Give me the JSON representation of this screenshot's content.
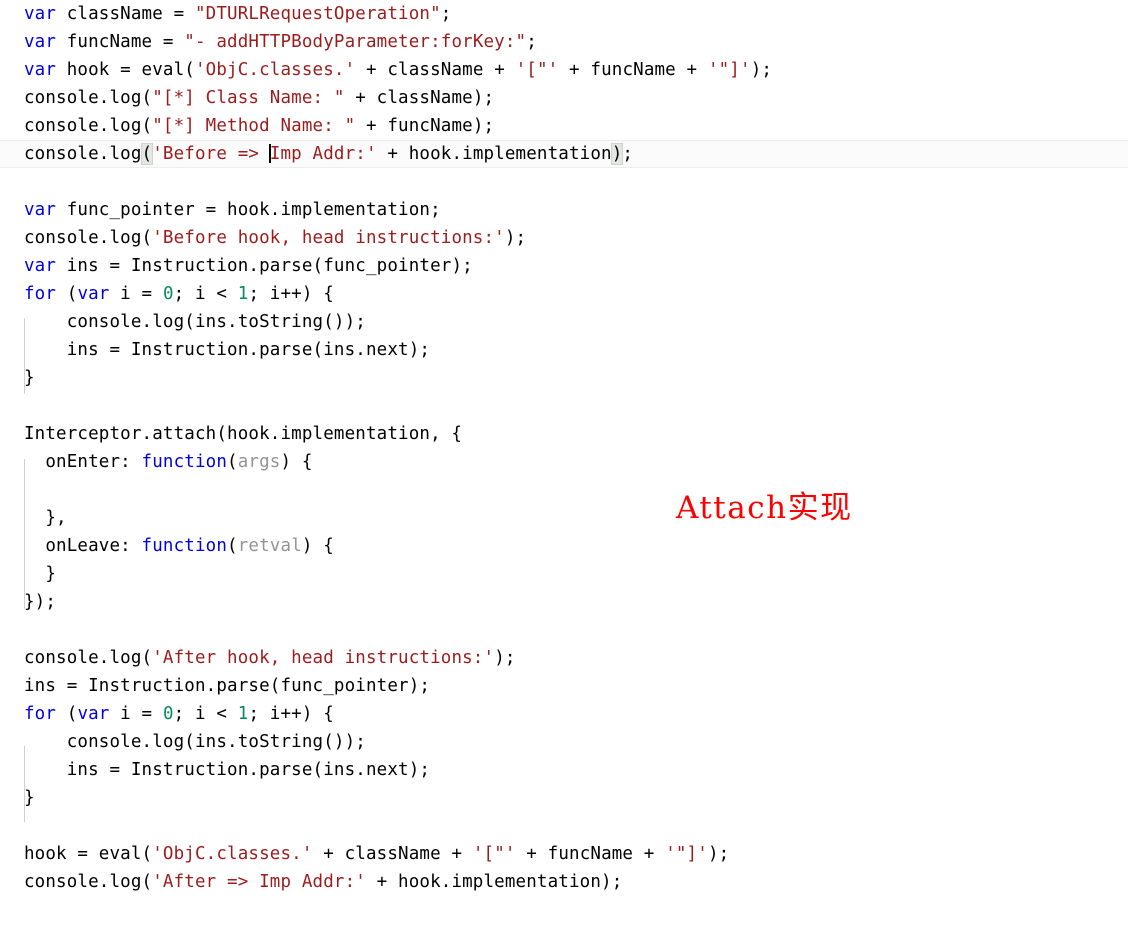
{
  "editor": {
    "language": "javascript",
    "background": "#ffffff",
    "colors": {
      "keyword": "#0000e0",
      "string": "#9c1c1c",
      "number": "#0a8a5c",
      "parameter": "#949494",
      "plain": "#000000",
      "current_line": "#fbfbfb",
      "bracket_match": "#e3e6e3",
      "indent_guide": "#cfcfcf",
      "annotation": "#fd0000"
    }
  },
  "annotation": {
    "text": "Attach实现"
  },
  "code": {
    "line1": {
      "kw": "var",
      "mid": " className = ",
      "str": "\"DTURLRequestOperation\"",
      "end": ";"
    },
    "line2": {
      "kw": "var",
      "mid": " funcName = ",
      "str": "\"- addHTTPBodyParameter:forKey:\"",
      "end": ";"
    },
    "line3": {
      "kw": "var",
      "a": " hook = eval(",
      "s1": "'ObjC.classes.'",
      "b": " + className + ",
      "s2": "'[\"'",
      "c": " + funcName + ",
      "s3": "'\"]'",
      "d": ");"
    },
    "line4": {
      "a": "console.log(",
      "s1": "\"[*] Class Name: \"",
      "b": " + className);"
    },
    "line5": {
      "a": "console.log(",
      "s1": "\"[*] Method Name: \"",
      "b": " + funcName);"
    },
    "line6": {
      "a": "console.log",
      "open_paren": "(",
      "s1": "'Before => ",
      "s2": "Imp Addr:'",
      "b": " + hook.implementation",
      "close_paren": ")",
      "c": ";"
    },
    "line8": {
      "kw": "var",
      "a": " func_pointer = hook.implementation;"
    },
    "line9": {
      "a": "console.log(",
      "s1": "'Before hook, head instructions:'",
      "b": ");"
    },
    "line10": {
      "kw": "var",
      "a": " ins = Instruction.parse(func_pointer);"
    },
    "line11": {
      "kw_for": "for",
      "a": " (",
      "kw_var": "var",
      "b": " i = ",
      "n1": "0",
      "c": "; i < ",
      "n2": "1",
      "d": "; i++) {"
    },
    "line12": {
      "a": "    console.log(ins.toString());"
    },
    "line13": {
      "a": "    ins = Instruction.parse(ins.next);"
    },
    "line14": {
      "a": "}"
    },
    "line16": {
      "a": "Interceptor.attach(hook.implementation, {"
    },
    "line17": {
      "a": "  onEnter: ",
      "kw": "function",
      "b": "(",
      "param": "args",
      "c": ") {"
    },
    "line19": {
      "a": "  },"
    },
    "line20": {
      "a": "  onLeave: ",
      "kw": "function",
      "b": "(",
      "param": "retval",
      "c": ") {"
    },
    "line21": {
      "a": "  }"
    },
    "line22": {
      "a": "});"
    },
    "line24": {
      "a": "console.log(",
      "s1": "'After hook, head instructions:'",
      "b": ");"
    },
    "line25": {
      "a": "ins = Instruction.parse(func_pointer);"
    },
    "line26": {
      "kw_for": "for",
      "a": " (",
      "kw_var": "var",
      "b": " i = ",
      "n1": "0",
      "c": "; i < ",
      "n2": "1",
      "d": "; i++) {"
    },
    "line27": {
      "a": "    console.log(ins.toString());"
    },
    "line28": {
      "a": "    ins = Instruction.parse(ins.next);"
    },
    "line29": {
      "a": "}"
    },
    "line31": {
      "a": "hook = eval(",
      "s1": "'ObjC.classes.'",
      "b": " + className + ",
      "s2": "'[\"'",
      "c": " + funcName + ",
      "s3": "'\"]'",
      "d": ");"
    },
    "line32": {
      "a": "console.log(",
      "s1": "'After => Imp Addr:'",
      "b": " + hook.implementation);"
    }
  }
}
